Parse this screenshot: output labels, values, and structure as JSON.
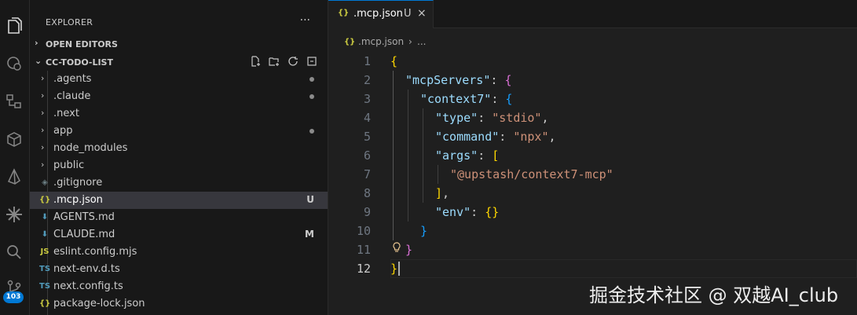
{
  "activity_bar": {
    "icons": [
      "files-icon",
      "remote-icon",
      "source-control-graph-icon",
      "extensions-icon",
      "prisma-icon",
      "ai-spark-icon",
      "search-icon",
      "source-control-icon"
    ],
    "badge": "103"
  },
  "explorer": {
    "title": "EXPLORER",
    "more": "···",
    "open_editors": "OPEN EDITORS",
    "project": "CC-TODO-LIST",
    "items": [
      {
        "name": ".agents",
        "type": "folder",
        "status": "dot"
      },
      {
        "name": ".claude",
        "type": "folder",
        "status": "dot"
      },
      {
        "name": ".next",
        "type": "folder",
        "status": ""
      },
      {
        "name": "app",
        "type": "folder",
        "status": "dot"
      },
      {
        "name": "node_modules",
        "type": "folder",
        "status": ""
      },
      {
        "name": "public",
        "type": "folder",
        "status": ""
      },
      {
        "name": ".gitignore",
        "type": "file",
        "icon": "◈",
        "status": ""
      },
      {
        "name": ".mcp.json",
        "type": "file",
        "icon": "{}",
        "status": "U"
      },
      {
        "name": "AGENTS.md",
        "type": "file",
        "icon": "⬇",
        "status": ""
      },
      {
        "name": "CLAUDE.md",
        "type": "file",
        "icon": "⬇",
        "status": "M"
      },
      {
        "name": "eslint.config.mjs",
        "type": "file",
        "icon": "JS",
        "status": ""
      },
      {
        "name": "next-env.d.ts",
        "type": "file",
        "icon": "TS",
        "status": ""
      },
      {
        "name": "next.config.ts",
        "type": "file",
        "icon": "TS",
        "status": ""
      },
      {
        "name": "package-lock.json",
        "type": "file",
        "icon": "{}",
        "status": ""
      }
    ]
  },
  "editor": {
    "tab": {
      "icon": "{}",
      "name": ".mcp.json",
      "status": "U",
      "close": "×"
    },
    "breadcrumb": {
      "icon": "{}",
      "file": ".mcp.json",
      "sep": "›",
      "more": "..."
    },
    "line_numbers": [
      "1",
      "2",
      "3",
      "4",
      "5",
      "6",
      "7",
      "8",
      "9",
      "10",
      "11",
      "12"
    ],
    "code": {
      "mcpServers": "\"mcpServers\"",
      "context7": "\"context7\"",
      "type_key": "\"type\"",
      "type_val": "\"stdio\"",
      "command_key": "\"command\"",
      "command_val": "\"npx\"",
      "args_key": "\"args\"",
      "args_item": "\"@upstash/context7-mcp\"",
      "env_key": "\"env\""
    }
  },
  "watermark": "掘金技术社区 @ 双越AI_club",
  "colors": {
    "accent": "#0078d4",
    "selection": "#37373d",
    "key": "#9cdcfe",
    "string": "#ce9178"
  }
}
